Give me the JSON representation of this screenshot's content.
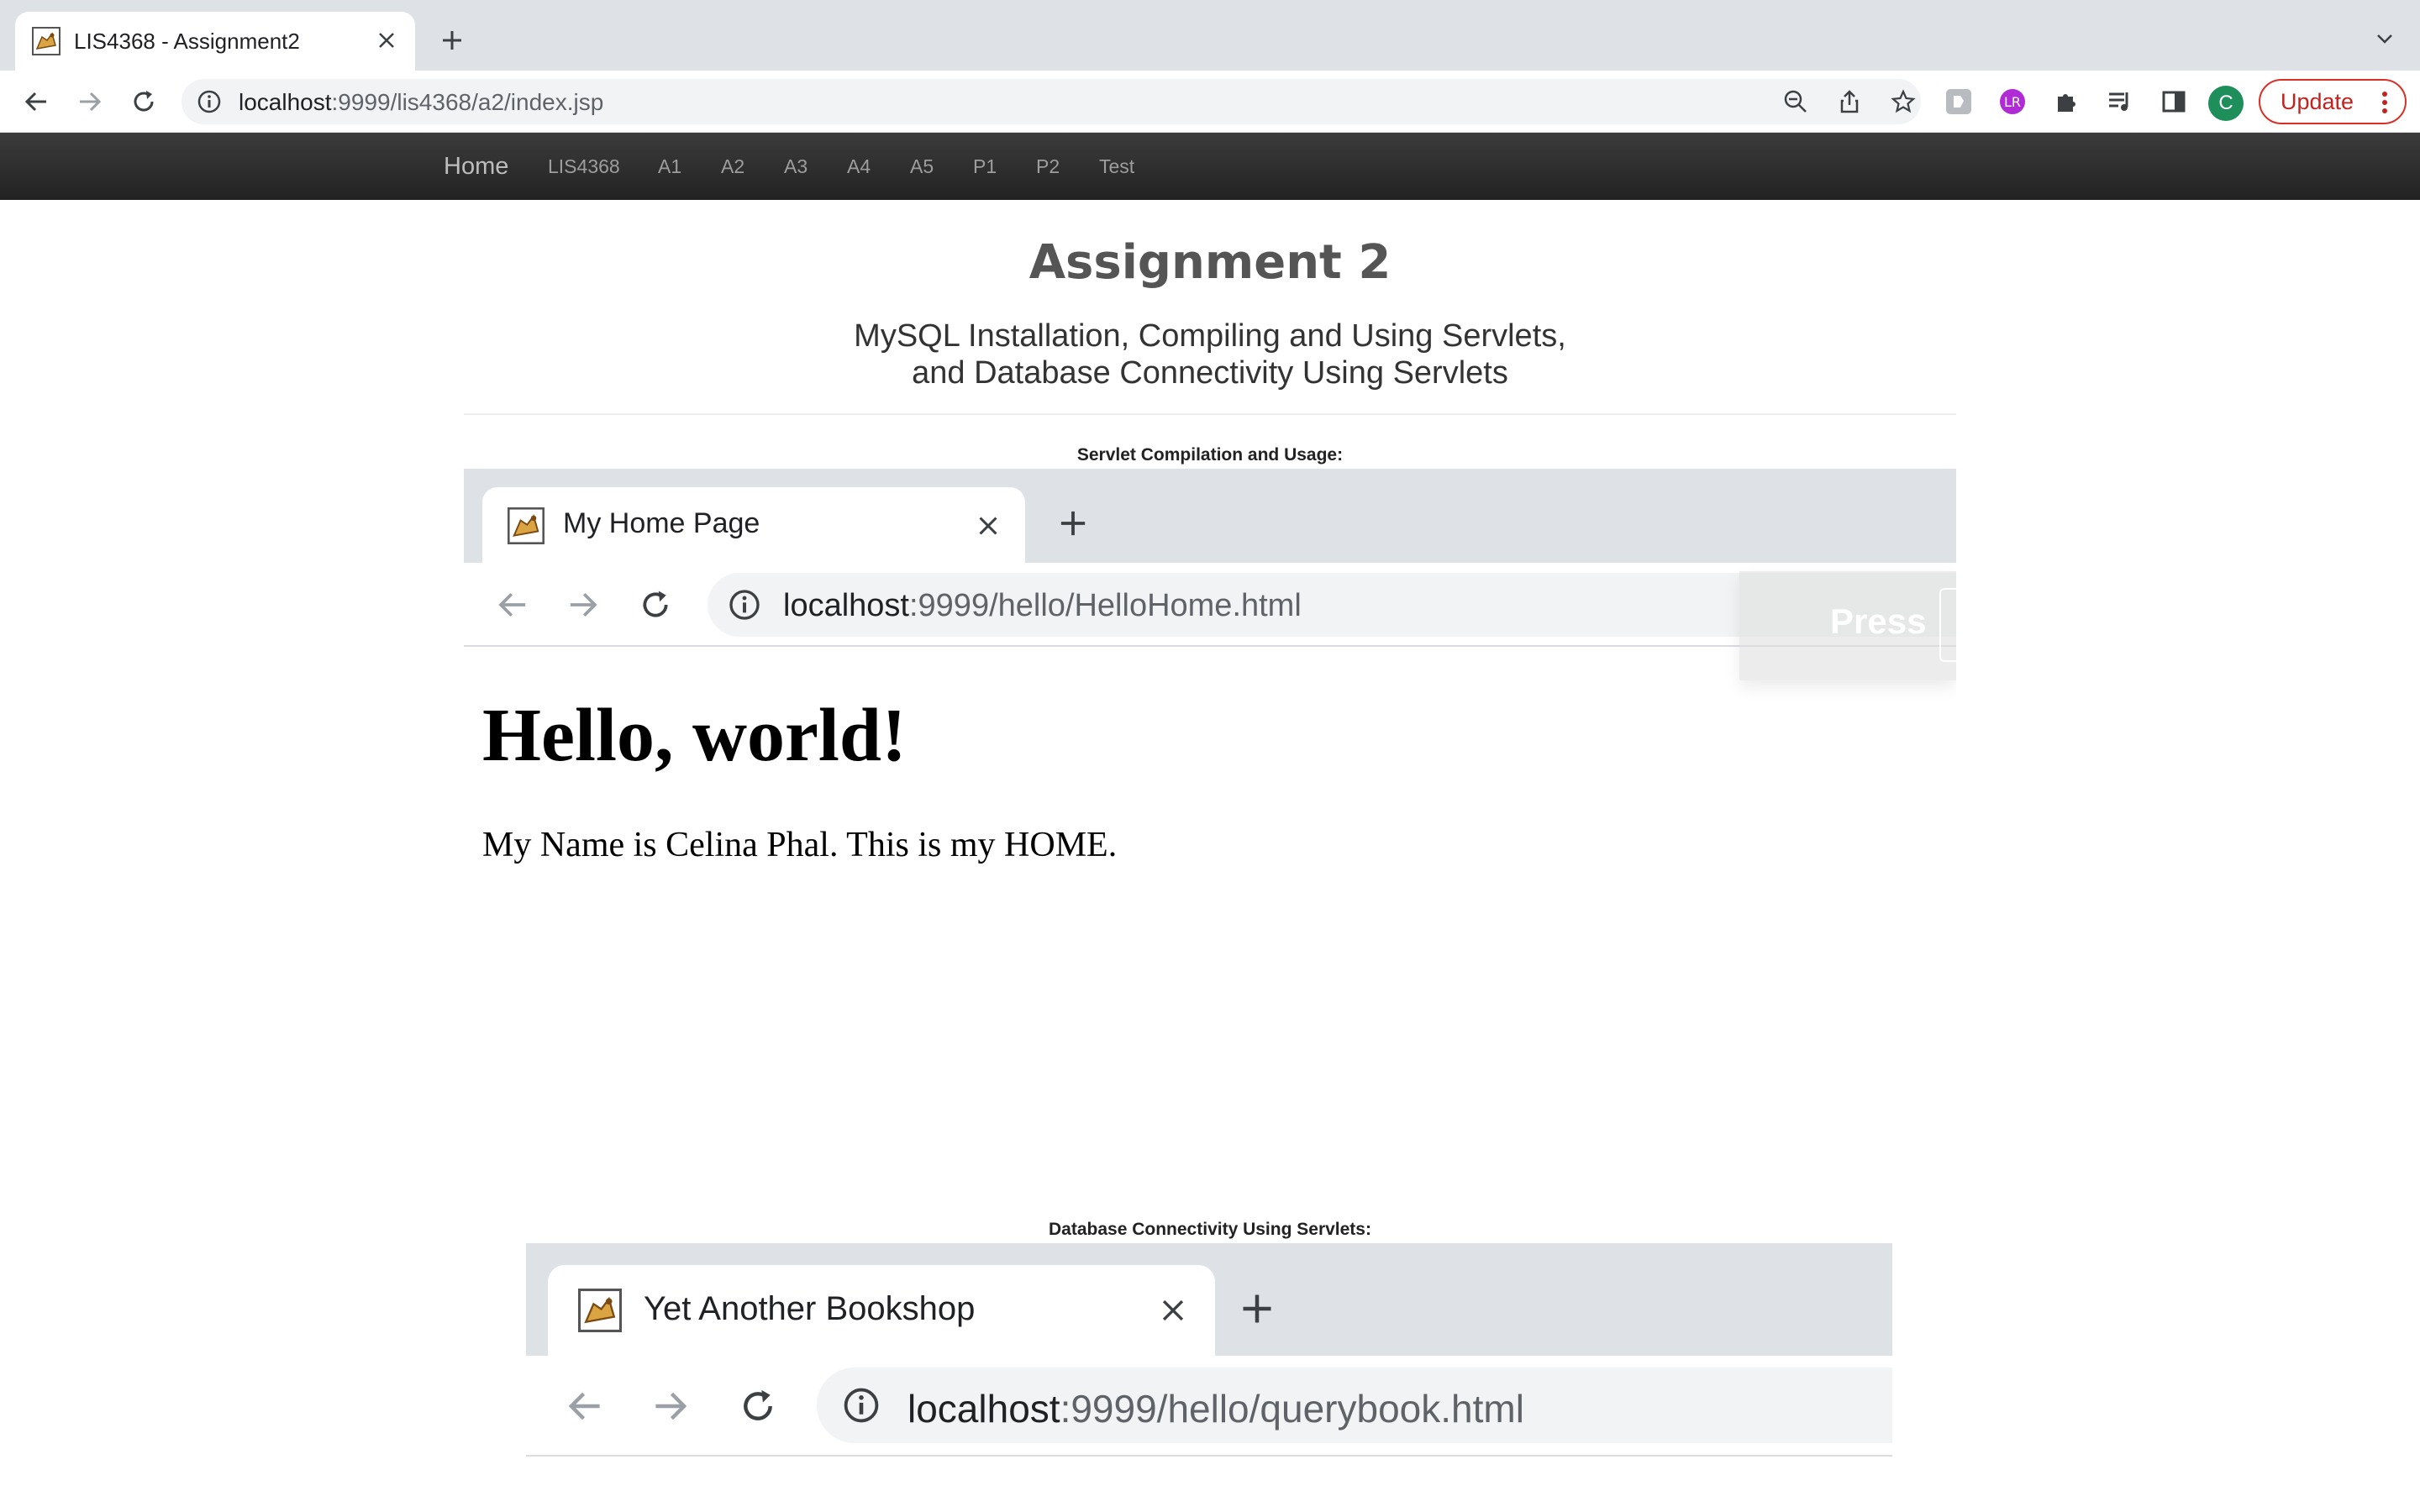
{
  "browser": {
    "tab_title": "LIS4368 - Assignment2",
    "url_host": "localhost",
    "url_rest": ":9999/lis4368/a2/index.jsp",
    "profile_initial": "C",
    "update_label": "Update",
    "accent_color": "#d93025"
  },
  "sitenav": {
    "items": [
      {
        "label": "Home"
      },
      {
        "label": "LIS4368"
      },
      {
        "label": "A1"
      },
      {
        "label": "A2"
      },
      {
        "label": "A3"
      },
      {
        "label": "A4"
      },
      {
        "label": "A5"
      },
      {
        "label": "P1"
      },
      {
        "label": "P2"
      },
      {
        "label": "Test"
      }
    ]
  },
  "page": {
    "title": "Assignment 2",
    "subtitle_line1": "MySQL Installation, Compiling and Using Servlets,",
    "subtitle_line2": "and Database Connectivity Using Servlets",
    "section1_label": "Servlet Compilation and Usage:",
    "section2_label": "Database Connectivity Using Servlets:"
  },
  "screenshot1": {
    "tab_title": "My Home Page",
    "url_host": "localhost",
    "url_rest": ":9999/hello/HelloHome.html",
    "overlay_text": "Press",
    "heading": "Hello, world!",
    "paragraph": "My Name is Celina Phal. This is my HOME."
  },
  "screenshot2": {
    "tab_title": "Yet Another Bookshop",
    "url_host": "localhost",
    "url_rest": ":9999/hello/querybook.html"
  }
}
